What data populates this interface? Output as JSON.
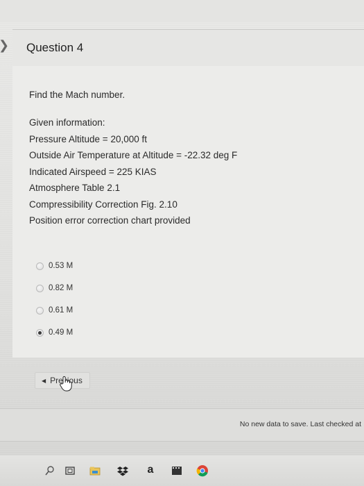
{
  "question": {
    "title": "Question 4",
    "prompt": "Find the Mach number.",
    "given_heading": "Given information:",
    "given_lines": [
      "Pressure Altitude = 20,000 ft",
      "Outside Air Temperature at Altitude = -22.32 deg F",
      "Indicated Airspeed = 225 KIAS",
      "Atmosphere Table 2.1",
      "Compressibility Correction Fig. 2.10",
      "Position error correction chart provided"
    ],
    "options": [
      {
        "label": "0.53 M",
        "selected": false
      },
      {
        "label": "0.82 M",
        "selected": false
      },
      {
        "label": "0.61 M",
        "selected": false
      },
      {
        "label": "0.49 M",
        "selected": true
      }
    ]
  },
  "navigation": {
    "previous_label": "Previous"
  },
  "status": {
    "text": "No new data to save. Last checked at"
  },
  "taskbar": {
    "icons": [
      "search-icon",
      "task-view-icon",
      "file-explorer-icon",
      "dropbox-icon",
      "amazon-icon",
      "media-icon",
      "chrome-icon"
    ],
    "amazon_glyph": "a"
  },
  "colors": {
    "page_background": "#e6e6e4",
    "selected_radio": "#3a3a3a"
  }
}
